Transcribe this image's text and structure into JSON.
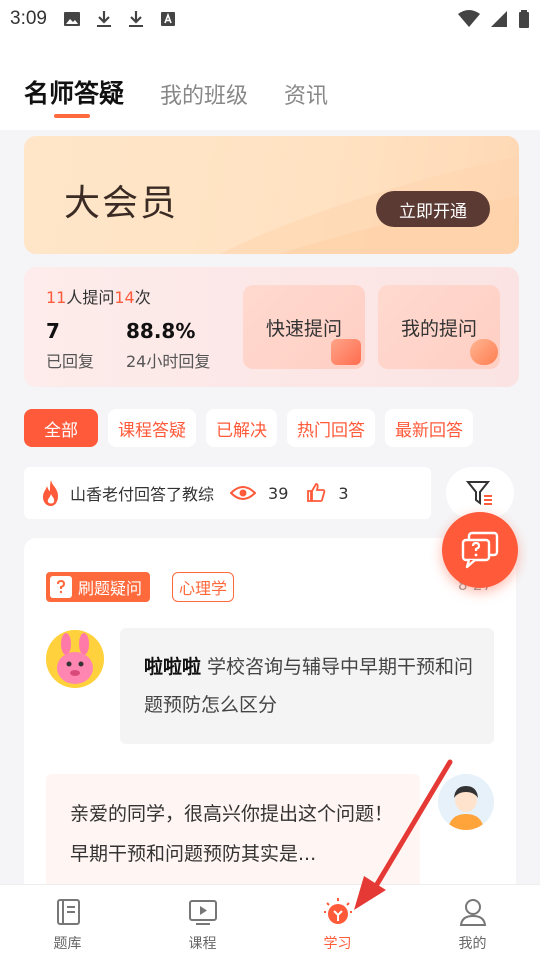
{
  "status_bar": {
    "time": "3:09"
  },
  "tabs": [
    {
      "label": "名师答疑",
      "active": true
    },
    {
      "label": "我的班级",
      "active": false
    },
    {
      "label": "资讯",
      "active": false
    }
  ],
  "banner": {
    "title": "大会员",
    "button": "立即开通"
  },
  "stats": {
    "asked_count": "11",
    "asked_text": "人提问",
    "times_count": "14",
    "times_text": "次",
    "replied_value": "7",
    "replied_label": "已回复",
    "rate_value": "88.8%",
    "rate_label": "24小时回复",
    "quick_ask": "快速提问",
    "my_questions": "我的提问"
  },
  "filters": [
    "全部",
    "课程答疑",
    "已解决",
    "热门回答",
    "最新回答"
  ],
  "ticker": {
    "text": "山香老付回答了教综",
    "views": "39",
    "likes": "3"
  },
  "question": {
    "tag_main": "刷题疑问",
    "tag_sub": "心理学",
    "date": "8-27",
    "asker": "啦啦啦",
    "text": "学校咨询与辅导中早期干预和问题预防怎么区分",
    "answer": "亲爱的同学，很高兴你提出这个问题！早期干预和问题预防其实是..."
  },
  "bottom_nav": [
    {
      "label": "题库",
      "icon": "question-bank-icon"
    },
    {
      "label": "课程",
      "icon": "video-course-icon"
    },
    {
      "label": "学习",
      "icon": "lightbulb-icon",
      "active": true
    },
    {
      "label": "我的",
      "icon": "profile-icon"
    }
  ],
  "colors": {
    "accent": "#ff5a3a",
    "banner_button": "#5a3a33"
  }
}
